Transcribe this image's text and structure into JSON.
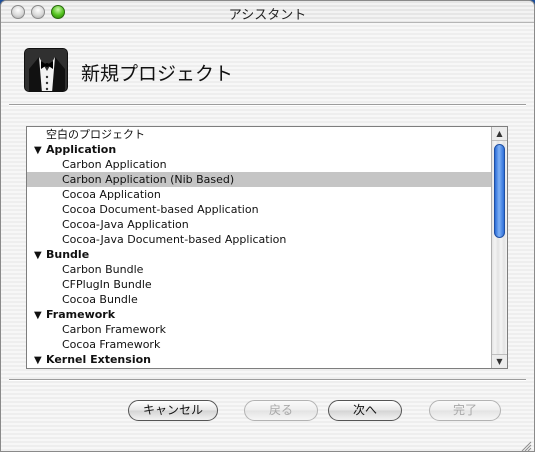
{
  "window": {
    "title": "アシスタント"
  },
  "header": {
    "title": "新規プロジェクト",
    "icon": "tuxedo-icon"
  },
  "project_list": {
    "rows": [
      {
        "label": "空白のプロジェクト",
        "kind": "plain",
        "selected": false
      },
      {
        "label": "Application",
        "kind": "group",
        "selected": false
      },
      {
        "label": "Carbon Application",
        "kind": "item",
        "selected": false
      },
      {
        "label": "Carbon Application (Nib Based)",
        "kind": "item",
        "selected": true
      },
      {
        "label": "Cocoa Application",
        "kind": "item",
        "selected": false
      },
      {
        "label": "Cocoa Document-based Application",
        "kind": "item",
        "selected": false
      },
      {
        "label": "Cocoa-Java Application",
        "kind": "item",
        "selected": false
      },
      {
        "label": "Cocoa-Java Document-based Application",
        "kind": "item",
        "selected": false
      },
      {
        "label": "Bundle",
        "kind": "group",
        "selected": false
      },
      {
        "label": "Carbon Bundle",
        "kind": "item",
        "selected": false
      },
      {
        "label": "CFPlugIn Bundle",
        "kind": "item",
        "selected": false
      },
      {
        "label": "Cocoa Bundle",
        "kind": "item",
        "selected": false
      },
      {
        "label": "Framework",
        "kind": "group",
        "selected": false
      },
      {
        "label": "Carbon Framework",
        "kind": "item",
        "selected": false
      },
      {
        "label": "Cocoa Framework",
        "kind": "item",
        "selected": false
      },
      {
        "label": "Kernel Extension",
        "kind": "group",
        "selected": false
      }
    ]
  },
  "footer": {
    "cancel_label": "キャンセル",
    "back_label": "戻る",
    "next_label": "次へ",
    "finish_label": "完了"
  },
  "colors": {
    "selection": "#c5c5c5",
    "scroll_thumb": "#2a6bd6",
    "desktop": "#1d4f9a"
  }
}
